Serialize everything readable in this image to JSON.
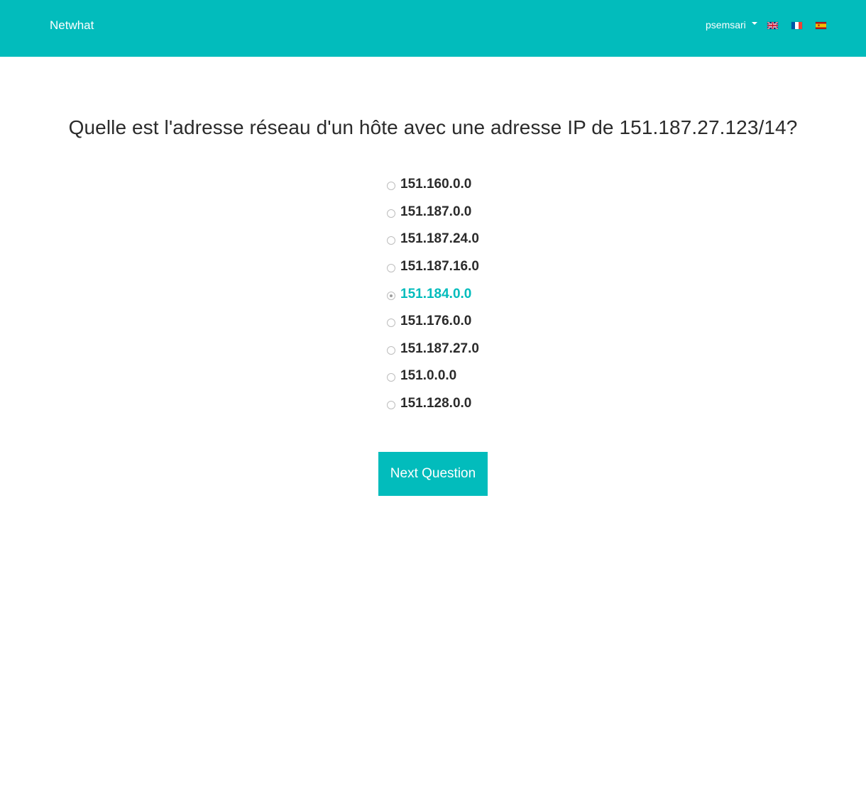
{
  "navbar": {
    "brand": "Netwhat",
    "username": "psemsari",
    "flags": [
      {
        "name": "uk-flag-icon",
        "lang": "en"
      },
      {
        "name": "france-flag-icon",
        "lang": "fr"
      },
      {
        "name": "spain-flag-icon",
        "lang": "es"
      }
    ],
    "color": "#02bcbc"
  },
  "quiz": {
    "question": "Quelle est l'adresse réseau d'un hôte avec une adresse IP de 151.187.27.123/14?",
    "options": [
      {
        "label": "151.160.0.0",
        "selected": false
      },
      {
        "label": "151.187.0.0",
        "selected": false
      },
      {
        "label": "151.187.24.0",
        "selected": false
      },
      {
        "label": "151.187.16.0",
        "selected": false
      },
      {
        "label": "151.184.0.0",
        "selected": true
      },
      {
        "label": "151.176.0.0",
        "selected": false
      },
      {
        "label": "151.187.27.0",
        "selected": false
      },
      {
        "label": "151.0.0.0",
        "selected": false
      },
      {
        "label": "151.128.0.0",
        "selected": false
      }
    ],
    "next_label": "Next Question",
    "accent_color": "#02bcbc"
  }
}
